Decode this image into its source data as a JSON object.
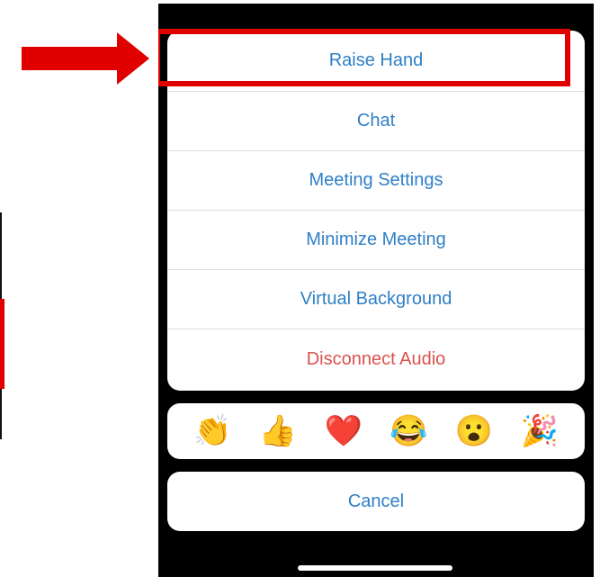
{
  "action_sheet": {
    "items": [
      {
        "label": "Raise Hand",
        "style": "normal"
      },
      {
        "label": "Chat",
        "style": "normal"
      },
      {
        "label": "Meeting Settings",
        "style": "normal"
      },
      {
        "label": "Minimize Meeting",
        "style": "normal"
      },
      {
        "label": "Virtual Background",
        "style": "normal"
      },
      {
        "label": "Disconnect Audio",
        "style": "destructive"
      }
    ]
  },
  "reactions": [
    "👏",
    "👍",
    "❤️",
    "😂",
    "😮",
    "🎉"
  ],
  "cancel_label": "Cancel",
  "colors": {
    "accent": "#2f7fc6",
    "destructive": "#d9534f",
    "annotation": "#e00000",
    "background": "#000000"
  },
  "annotation": {
    "highlighted_item": "Raise Hand",
    "arrow_icon": "arrow-right-icon"
  }
}
